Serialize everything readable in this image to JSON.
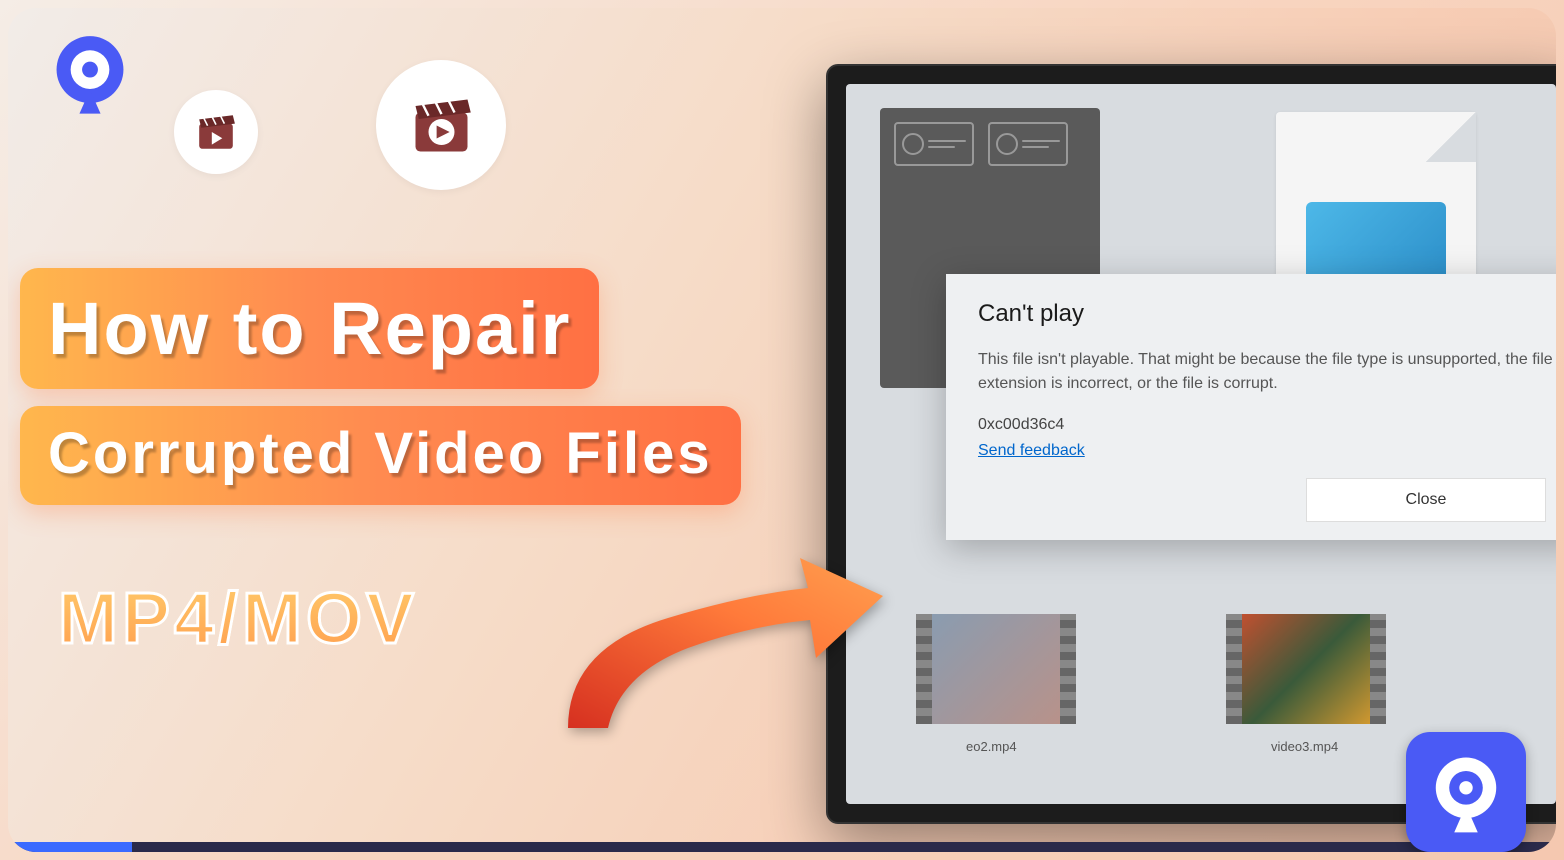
{
  "title_line1": "How to Repair",
  "title_line2": "Corrupted Video Files",
  "subtitle": "MP4/MOV",
  "dialog": {
    "title": "Can't play",
    "body": "This file isn't playable. That might be because the file type is unsupported, the file extension is incorrect, or the file is corrupt.",
    "error_code": "0xc00d36c4",
    "feedback_link": "Send feedback",
    "close_button": "Close"
  },
  "videos": {
    "file2": "eo2.mp4",
    "file3": "video3.mp4"
  },
  "icons": {
    "logo": "recoverit-logo-icon",
    "clapper_small": "clapperboard-play-icon",
    "clapper_large": "clapperboard-play-icon"
  }
}
